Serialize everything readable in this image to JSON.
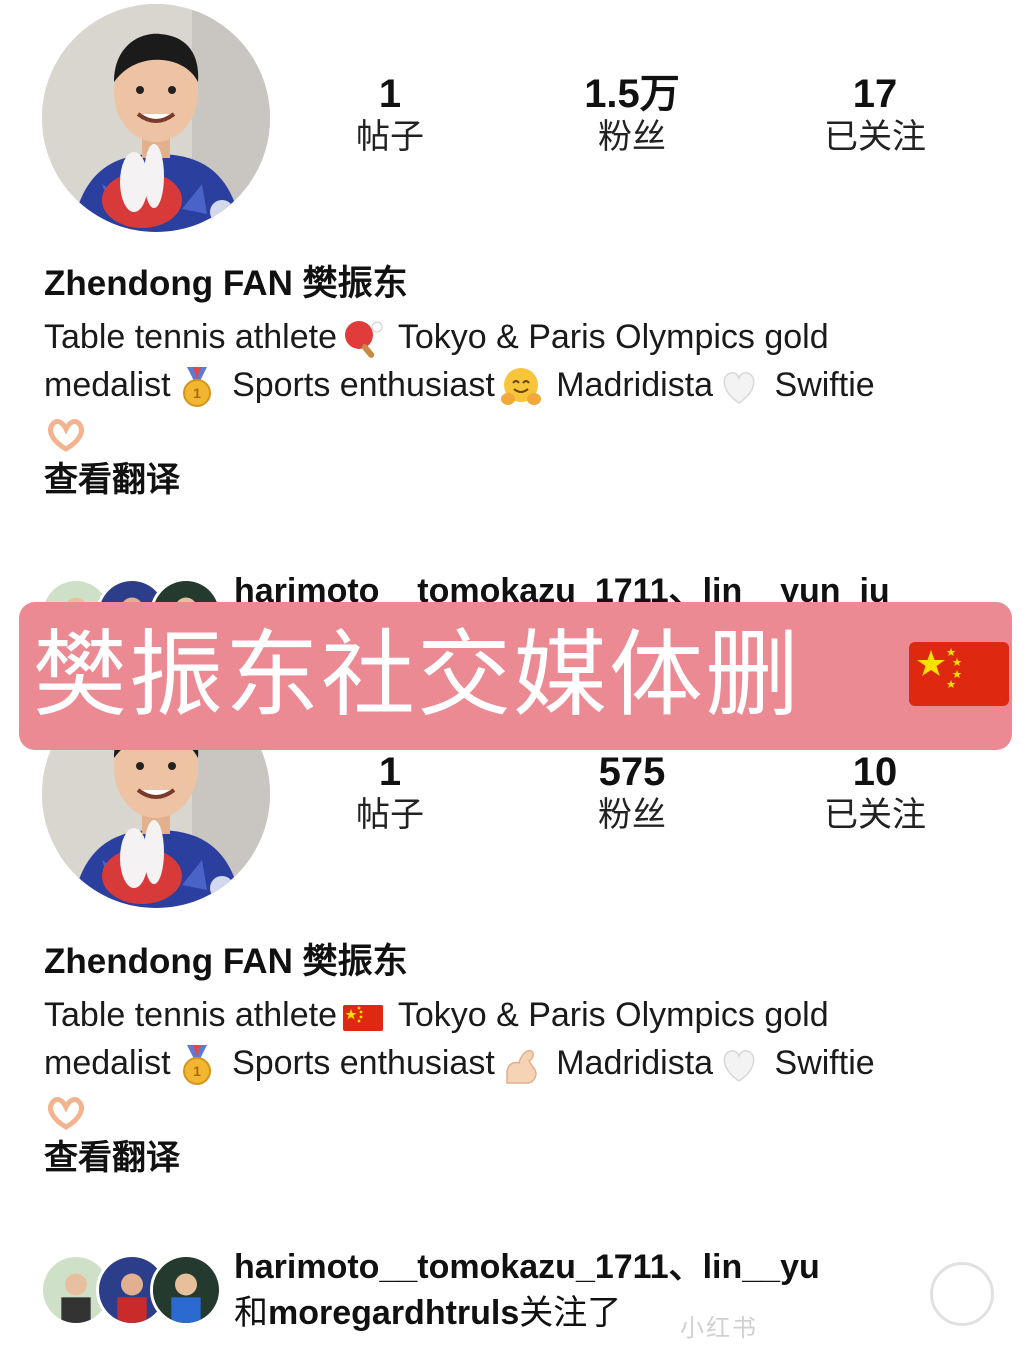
{
  "top_profile": {
    "stats": [
      {
        "value": "1",
        "label": "帖子"
      },
      {
        "value": "1.5万",
        "label": "粉丝"
      },
      {
        "value": "17",
        "label": "已关注"
      }
    ],
    "name": "Zhendong FAN 樊振东",
    "bio": {
      "line1_a": "Table tennis athlete",
      "line1_b": "Tokyo & Paris Olympics gold",
      "line2_a": "medalist",
      "line2_b": "Sports enthusiast",
      "line2_c": "Madridista",
      "line2_d": "Swiftie"
    },
    "emojis": [
      "ping-pong",
      "gold-medal",
      "hugging-face",
      "white-heart",
      "heart-hands"
    ],
    "translate_link": "查看翻译",
    "followed_by": {
      "users": "harimoto__tomokazu_1711、lin__yun_ju"
    }
  },
  "banner": {
    "text": "樊振东社交媒体删",
    "flag": "china-flag"
  },
  "bottom_profile": {
    "stats": [
      {
        "value": "1",
        "label": "帖子"
      },
      {
        "value": "575",
        "label": "粉丝"
      },
      {
        "value": "10",
        "label": "已关注"
      }
    ],
    "name": "Zhendong FAN 樊振东",
    "bio": {
      "line1_a": "Table tennis athlete",
      "line1_b": "Tokyo & Paris Olympics gold",
      "line2_a": "medalist",
      "line2_b": "Sports enthusiast",
      "line2_c": "Madridista",
      "line2_d": "Swiftie"
    },
    "emojis": [
      "china-flag",
      "gold-medal",
      "flexed-biceps",
      "white-heart",
      "heart-hands"
    ],
    "translate_link": "查看翻译",
    "followed_by": {
      "users": "harimoto__tomokazu_1711、lin__yu",
      "prefix": "和",
      "last_user": "moregardhtruls",
      "suffix": "关注了"
    }
  },
  "watermark": "小红书",
  "colors": {
    "banner_bg": "#eb8a93",
    "banner_text": "#ffffff",
    "jersey_blue": "#2a3f9e"
  }
}
